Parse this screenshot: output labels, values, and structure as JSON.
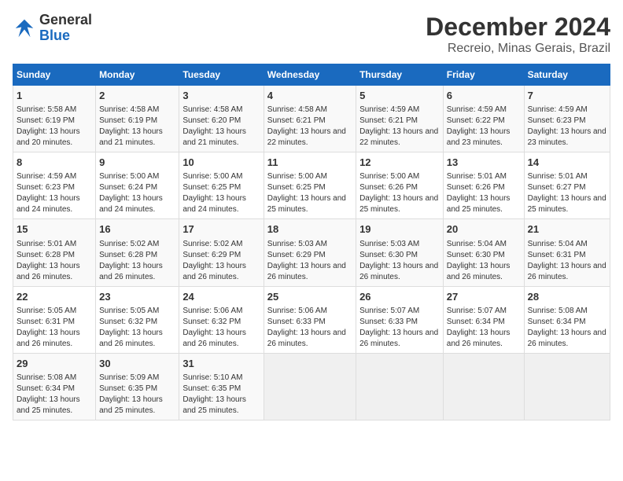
{
  "logo": {
    "line1": "General",
    "line2": "Blue"
  },
  "title": "December 2024",
  "subtitle": "Recreio, Minas Gerais, Brazil",
  "days_of_week": [
    "Sunday",
    "Monday",
    "Tuesday",
    "Wednesday",
    "Thursday",
    "Friday",
    "Saturday"
  ],
  "weeks": [
    [
      {
        "day": "1",
        "sunrise": "5:58 AM",
        "sunset": "6:19 PM",
        "daylight": "13 hours and 20 minutes."
      },
      {
        "day": "2",
        "sunrise": "4:58 AM",
        "sunset": "6:19 PM",
        "daylight": "13 hours and 21 minutes."
      },
      {
        "day": "3",
        "sunrise": "4:58 AM",
        "sunset": "6:20 PM",
        "daylight": "13 hours and 21 minutes."
      },
      {
        "day": "4",
        "sunrise": "4:58 AM",
        "sunset": "6:21 PM",
        "daylight": "13 hours and 22 minutes."
      },
      {
        "day": "5",
        "sunrise": "4:59 AM",
        "sunset": "6:21 PM",
        "daylight": "13 hours and 22 minutes."
      },
      {
        "day": "6",
        "sunrise": "4:59 AM",
        "sunset": "6:22 PM",
        "daylight": "13 hours and 23 minutes."
      },
      {
        "day": "7",
        "sunrise": "4:59 AM",
        "sunset": "6:23 PM",
        "daylight": "13 hours and 23 minutes."
      }
    ],
    [
      {
        "day": "8",
        "sunrise": "4:59 AM",
        "sunset": "6:23 PM",
        "daylight": "13 hours and 24 minutes."
      },
      {
        "day": "9",
        "sunrise": "5:00 AM",
        "sunset": "6:24 PM",
        "daylight": "13 hours and 24 minutes."
      },
      {
        "day": "10",
        "sunrise": "5:00 AM",
        "sunset": "6:25 PM",
        "daylight": "13 hours and 24 minutes."
      },
      {
        "day": "11",
        "sunrise": "5:00 AM",
        "sunset": "6:25 PM",
        "daylight": "13 hours and 25 minutes."
      },
      {
        "day": "12",
        "sunrise": "5:00 AM",
        "sunset": "6:26 PM",
        "daylight": "13 hours and 25 minutes."
      },
      {
        "day": "13",
        "sunrise": "5:01 AM",
        "sunset": "6:26 PM",
        "daylight": "13 hours and 25 minutes."
      },
      {
        "day": "14",
        "sunrise": "5:01 AM",
        "sunset": "6:27 PM",
        "daylight": "13 hours and 25 minutes."
      }
    ],
    [
      {
        "day": "15",
        "sunrise": "5:01 AM",
        "sunset": "6:28 PM",
        "daylight": "13 hours and 26 minutes."
      },
      {
        "day": "16",
        "sunrise": "5:02 AM",
        "sunset": "6:28 PM",
        "daylight": "13 hours and 26 minutes."
      },
      {
        "day": "17",
        "sunrise": "5:02 AM",
        "sunset": "6:29 PM",
        "daylight": "13 hours and 26 minutes."
      },
      {
        "day": "18",
        "sunrise": "5:03 AM",
        "sunset": "6:29 PM",
        "daylight": "13 hours and 26 minutes."
      },
      {
        "day": "19",
        "sunrise": "5:03 AM",
        "sunset": "6:30 PM",
        "daylight": "13 hours and 26 minutes."
      },
      {
        "day": "20",
        "sunrise": "5:04 AM",
        "sunset": "6:30 PM",
        "daylight": "13 hours and 26 minutes."
      },
      {
        "day": "21",
        "sunrise": "5:04 AM",
        "sunset": "6:31 PM",
        "daylight": "13 hours and 26 minutes."
      }
    ],
    [
      {
        "day": "22",
        "sunrise": "5:05 AM",
        "sunset": "6:31 PM",
        "daylight": "13 hours and 26 minutes."
      },
      {
        "day": "23",
        "sunrise": "5:05 AM",
        "sunset": "6:32 PM",
        "daylight": "13 hours and 26 minutes."
      },
      {
        "day": "24",
        "sunrise": "5:06 AM",
        "sunset": "6:32 PM",
        "daylight": "13 hours and 26 minutes."
      },
      {
        "day": "25",
        "sunrise": "5:06 AM",
        "sunset": "6:33 PM",
        "daylight": "13 hours and 26 minutes."
      },
      {
        "day": "26",
        "sunrise": "5:07 AM",
        "sunset": "6:33 PM",
        "daylight": "13 hours and 26 minutes."
      },
      {
        "day": "27",
        "sunrise": "5:07 AM",
        "sunset": "6:34 PM",
        "daylight": "13 hours and 26 minutes."
      },
      {
        "day": "28",
        "sunrise": "5:08 AM",
        "sunset": "6:34 PM",
        "daylight": "13 hours and 26 minutes."
      }
    ],
    [
      {
        "day": "29",
        "sunrise": "5:08 AM",
        "sunset": "6:34 PM",
        "daylight": "13 hours and 25 minutes."
      },
      {
        "day": "30",
        "sunrise": "5:09 AM",
        "sunset": "6:35 PM",
        "daylight": "13 hours and 25 minutes."
      },
      {
        "day": "31",
        "sunrise": "5:10 AM",
        "sunset": "6:35 PM",
        "daylight": "13 hours and 25 minutes."
      },
      null,
      null,
      null,
      null
    ]
  ]
}
